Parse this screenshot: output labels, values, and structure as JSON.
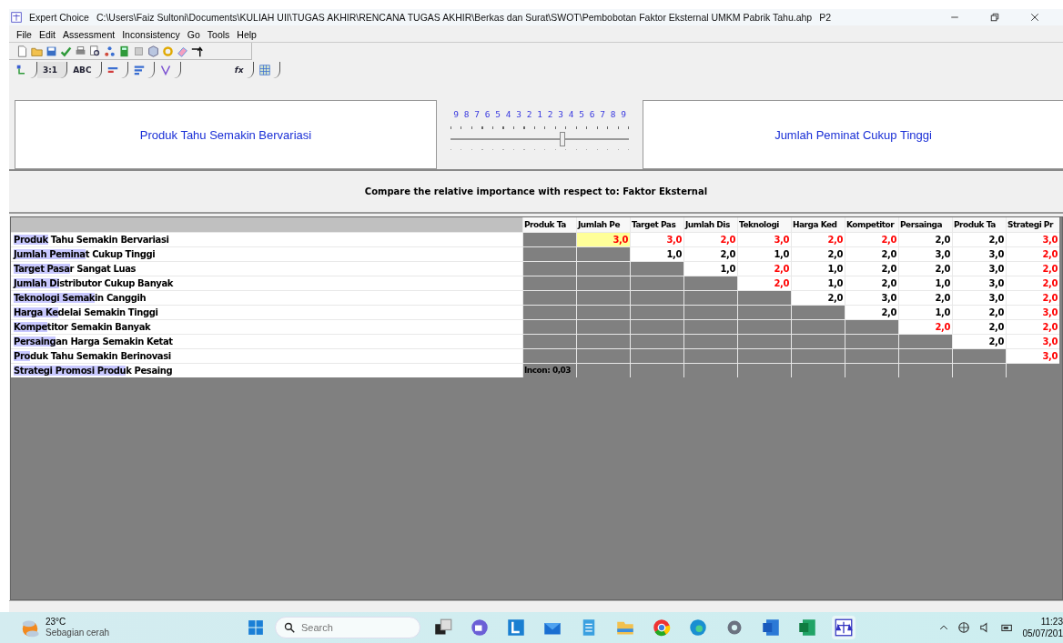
{
  "window": {
    "app_name": "Expert Choice",
    "path": "C:\\Users\\Faiz Sultoni\\Documents\\KULIAH UII\\TUGAS AKHIR\\RENCANA TUGAS AKHIR\\Berkas dan Surat\\SWOT\\Pembobotan Faktor Eksternal UMKM Pabrik Tahu.ahp",
    "node": "P2"
  },
  "menu": [
    "File",
    "Edit",
    "Assessment",
    "Inconsistency",
    "Go",
    "Tools",
    "Help"
  ],
  "tabs": [
    {
      "kind": "icon",
      "selected": false
    },
    {
      "kind": "text",
      "label": "3:1",
      "selected": true
    },
    {
      "kind": "text",
      "label": "ABC",
      "selected": false
    },
    {
      "kind": "icon",
      "selected": false
    },
    {
      "kind": "icon",
      "selected": false
    },
    {
      "kind": "icon",
      "selected": false
    },
    {
      "kind": "text",
      "label": "fx",
      "selected": false
    },
    {
      "kind": "icon",
      "selected": false
    }
  ],
  "comparison": {
    "left": "Produk Tahu Semakin Bervariasi",
    "right": "Jumlah Peminat Cukup Tinggi",
    "scale": [
      "9",
      "8",
      "7",
      "6",
      "5",
      "4",
      "3",
      "2",
      "1",
      "2",
      "3",
      "4",
      "5",
      "6",
      "7",
      "8",
      "9"
    ],
    "level": 0.625
  },
  "prompt": "Compare the relative importance with respect to: Faktor Eksternal",
  "grid": {
    "columns": [
      "Produk Ta",
      "Jumlah Pe",
      "Target Pas",
      "Jumlah Dis",
      "Teknologi",
      "Harga Ked",
      "Kompetitor",
      "Persainga",
      "Produk Ta",
      "Strategi Pr"
    ],
    "rows": [
      {
        "typed": "Produk",
        "rest": " Tahu Semakin Bervariasi",
        "cells": [
          {
            "kind": "gray"
          },
          {
            "kind": "value",
            "value": "3,0",
            "inverted": true,
            "selected": true
          },
          {
            "kind": "value",
            "value": "3,0",
            "inverted": true,
            "selected": false
          },
          {
            "kind": "value",
            "value": "2,0",
            "inverted": true,
            "selected": false
          },
          {
            "kind": "value",
            "value": "3,0",
            "inverted": true,
            "selected": false
          },
          {
            "kind": "value",
            "value": "2,0",
            "inverted": true,
            "selected": false
          },
          {
            "kind": "value",
            "value": "2,0",
            "inverted": true,
            "selected": false
          },
          {
            "kind": "value",
            "value": "2,0",
            "inverted": false,
            "selected": false
          },
          {
            "kind": "value",
            "value": "2,0",
            "inverted": false,
            "selected": false
          },
          {
            "kind": "value",
            "value": "3,0",
            "inverted": true,
            "selected": false
          }
        ]
      },
      {
        "typed": "Jumlah Pemina",
        "rest": "t Cukup Tinggi",
        "cells": [
          {
            "kind": "gray"
          },
          {
            "kind": "gray"
          },
          {
            "kind": "value",
            "value": "1,0",
            "inverted": false,
            "selected": false
          },
          {
            "kind": "value",
            "value": "2,0",
            "inverted": false,
            "selected": false
          },
          {
            "kind": "value",
            "value": "1,0",
            "inverted": false,
            "selected": false
          },
          {
            "kind": "value",
            "value": "2,0",
            "inverted": false,
            "selected": false
          },
          {
            "kind": "value",
            "value": "2,0",
            "inverted": false,
            "selected": false
          },
          {
            "kind": "value",
            "value": "3,0",
            "inverted": false,
            "selected": false
          },
          {
            "kind": "value",
            "value": "3,0",
            "inverted": false,
            "selected": false
          },
          {
            "kind": "value",
            "value": "2,0",
            "inverted": true,
            "selected": false
          }
        ]
      },
      {
        "typed": "Target Pasa",
        "rest": "r Sangat Luas",
        "cells": [
          {
            "kind": "gray"
          },
          {
            "kind": "gray"
          },
          {
            "kind": "gray"
          },
          {
            "kind": "value",
            "value": "1,0",
            "inverted": false,
            "selected": false
          },
          {
            "kind": "value",
            "value": "2,0",
            "inverted": true,
            "selected": false
          },
          {
            "kind": "value",
            "value": "1,0",
            "inverted": false,
            "selected": false
          },
          {
            "kind": "value",
            "value": "2,0",
            "inverted": false,
            "selected": false
          },
          {
            "kind": "value",
            "value": "2,0",
            "inverted": false,
            "selected": false
          },
          {
            "kind": "value",
            "value": "3,0",
            "inverted": false,
            "selected": false
          },
          {
            "kind": "value",
            "value": "2,0",
            "inverted": true,
            "selected": false
          }
        ]
      },
      {
        "typed": "Jumlah Di",
        "rest": "stributor Cukup Banyak",
        "cells": [
          {
            "kind": "gray"
          },
          {
            "kind": "gray"
          },
          {
            "kind": "gray"
          },
          {
            "kind": "gray"
          },
          {
            "kind": "value",
            "value": "2,0",
            "inverted": true,
            "selected": false
          },
          {
            "kind": "value",
            "value": "1,0",
            "inverted": false,
            "selected": false
          },
          {
            "kind": "value",
            "value": "2,0",
            "inverted": false,
            "selected": false
          },
          {
            "kind": "value",
            "value": "1,0",
            "inverted": false,
            "selected": false
          },
          {
            "kind": "value",
            "value": "3,0",
            "inverted": false,
            "selected": false
          },
          {
            "kind": "value",
            "value": "2,0",
            "inverted": true,
            "selected": false
          }
        ]
      },
      {
        "typed": "Teknologi Semak",
        "rest": "in Canggih",
        "cells": [
          {
            "kind": "gray"
          },
          {
            "kind": "gray"
          },
          {
            "kind": "gray"
          },
          {
            "kind": "gray"
          },
          {
            "kind": "gray"
          },
          {
            "kind": "value",
            "value": "2,0",
            "inverted": false,
            "selected": false
          },
          {
            "kind": "value",
            "value": "3,0",
            "inverted": false,
            "selected": false
          },
          {
            "kind": "value",
            "value": "2,0",
            "inverted": false,
            "selected": false
          },
          {
            "kind": "value",
            "value": "3,0",
            "inverted": false,
            "selected": false
          },
          {
            "kind": "value",
            "value": "2,0",
            "inverted": true,
            "selected": false
          }
        ]
      },
      {
        "typed": "Harga Ke",
        "rest": "delai Semakin Tinggi",
        "cells": [
          {
            "kind": "gray"
          },
          {
            "kind": "gray"
          },
          {
            "kind": "gray"
          },
          {
            "kind": "gray"
          },
          {
            "kind": "gray"
          },
          {
            "kind": "gray"
          },
          {
            "kind": "value",
            "value": "2,0",
            "inverted": false,
            "selected": false
          },
          {
            "kind": "value",
            "value": "1,0",
            "inverted": false,
            "selected": false
          },
          {
            "kind": "value",
            "value": "2,0",
            "inverted": false,
            "selected": false
          },
          {
            "kind": "value",
            "value": "3,0",
            "inverted": true,
            "selected": false
          }
        ]
      },
      {
        "typed": "Kompe",
        "rest": "titor Semakin Banyak",
        "cells": [
          {
            "kind": "gray"
          },
          {
            "kind": "gray"
          },
          {
            "kind": "gray"
          },
          {
            "kind": "gray"
          },
          {
            "kind": "gray"
          },
          {
            "kind": "gray"
          },
          {
            "kind": "gray"
          },
          {
            "kind": "value",
            "value": "2,0",
            "inverted": true,
            "selected": false
          },
          {
            "kind": "value",
            "value": "2,0",
            "inverted": false,
            "selected": false
          },
          {
            "kind": "value",
            "value": "2,0",
            "inverted": true,
            "selected": false
          }
        ]
      },
      {
        "typed": "Persaing",
        "rest": "an Harga Semakin Ketat",
        "cells": [
          {
            "kind": "gray"
          },
          {
            "kind": "gray"
          },
          {
            "kind": "gray"
          },
          {
            "kind": "gray"
          },
          {
            "kind": "gray"
          },
          {
            "kind": "gray"
          },
          {
            "kind": "gray"
          },
          {
            "kind": "gray"
          },
          {
            "kind": "value",
            "value": "2,0",
            "inverted": false,
            "selected": false
          },
          {
            "kind": "value",
            "value": "3,0",
            "inverted": true,
            "selected": false
          }
        ]
      },
      {
        "typed": "Pro",
        "rest": "duk Tahu Semakin Berinovasi",
        "cells": [
          {
            "kind": "gray"
          },
          {
            "kind": "gray"
          },
          {
            "kind": "gray"
          },
          {
            "kind": "gray"
          },
          {
            "kind": "gray"
          },
          {
            "kind": "gray"
          },
          {
            "kind": "gray"
          },
          {
            "kind": "gray"
          },
          {
            "kind": "gray"
          },
          {
            "kind": "value",
            "value": "3,0",
            "inverted": true,
            "selected": false
          }
        ]
      },
      {
        "typed": "Strategi Promosi Produ",
        "rest": "k Pesaing",
        "cells": [
          {
            "kind": "gray",
            "text": "Incon: 0,03"
          },
          {
            "kind": "gray"
          },
          {
            "kind": "gray"
          },
          {
            "kind": "gray"
          },
          {
            "kind": "gray"
          },
          {
            "kind": "gray"
          },
          {
            "kind": "gray"
          },
          {
            "kind": "gray"
          },
          {
            "kind": "gray"
          },
          {
            "kind": "gray"
          }
        ]
      }
    ]
  },
  "taskbar": {
    "temperature": "23°C",
    "weather": "Sebagian cerah",
    "search": {
      "placeholder": "Search"
    },
    "apps": [
      {
        "selected": false
      },
      {
        "selected": false
      },
      {
        "selected": false
      },
      {
        "selected": false
      },
      {
        "selected": false
      },
      {
        "selected": false
      },
      {
        "selected": false
      },
      {
        "selected": false
      },
      {
        "selected": false
      },
      {
        "selected": false
      },
      {
        "selected": false
      },
      {
        "selected": true
      }
    ],
    "time": "11:23",
    "date": "05/07/201"
  }
}
